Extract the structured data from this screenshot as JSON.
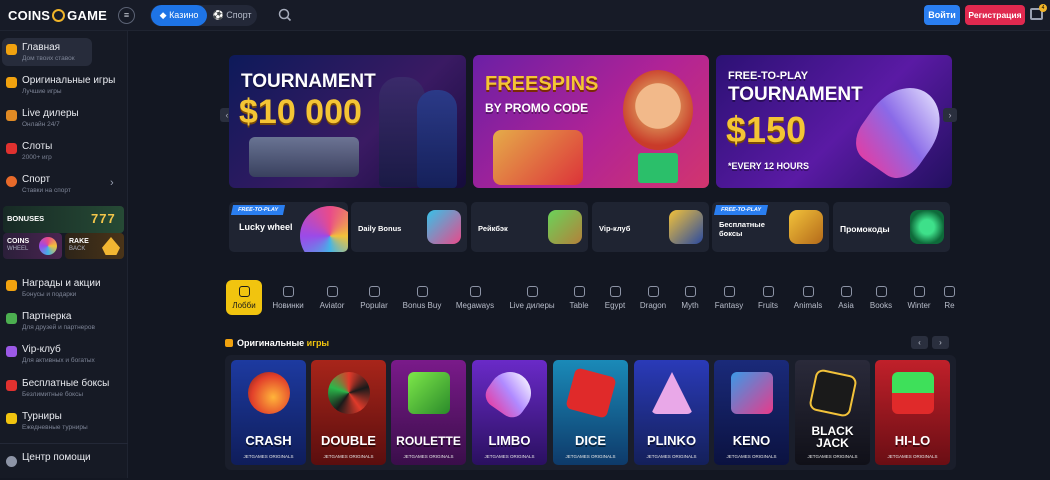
{
  "header": {
    "logo_left": "COINS",
    "logo_right": "GAME",
    "casino_label": "Казино",
    "sport_label": "Спорт",
    "login_label": "Войти",
    "register_label": "Регистрация",
    "chat_badge": "4"
  },
  "sidebar": {
    "items": [
      {
        "title": "Главная",
        "sub": "Дом твоих ставок",
        "icon": "home-icon"
      },
      {
        "title": "Оригинальные игры",
        "sub": "Лучшие игры",
        "icon": "cube-icon"
      },
      {
        "title": "Live дилеры",
        "sub": "Онлайн 24/7",
        "icon": "dealer-icon"
      },
      {
        "title": "Слоты",
        "sub": "2000+ игр",
        "icon": "slots-icon"
      },
      {
        "title": "Спорт",
        "sub": "Ставки на спорт",
        "icon": "ball-icon"
      }
    ],
    "bonuses_label": "BONUSES",
    "bonuses_value": "777",
    "coins_wheel_top": "COINS",
    "coins_wheel_bottom": "WHEEL",
    "rakeback_top": "RAKE",
    "rakeback_bottom": "BACK",
    "items2": [
      {
        "title": "Награды и акции",
        "sub": "Бонусы и подарки",
        "icon": "megaphone-icon"
      },
      {
        "title": "Партнерка",
        "sub": "Для друзей и партнеров",
        "icon": "partner-icon"
      },
      {
        "title": "Vip-клуб",
        "sub": "Для активных и богатых",
        "icon": "vip-icon"
      },
      {
        "title": "Бесплатные боксы",
        "sub": "Безлимитные боксы",
        "icon": "box-icon"
      },
      {
        "title": "Турниры",
        "sub": "Ежедневные турниры",
        "icon": "trophy-icon"
      }
    ],
    "help_label": "Центр помощи"
  },
  "banners": [
    {
      "line1": "TOURNAMENT",
      "line2": "$10 000"
    },
    {
      "line1": "FREESPINS",
      "line2": "BY PROMO CODE"
    },
    {
      "line1": "FREE-TO-PLAY",
      "line2": "TOURNAMENT",
      "line3": "$150",
      "line4": "*EVERY 12 HOURS"
    }
  ],
  "promos": [
    {
      "label": "Lucky wheel",
      "tag": "FREE-TO-PLAY"
    },
    {
      "label": "Daily Bonus"
    },
    {
      "label": "Рейкбэк"
    },
    {
      "label": "Vip-клуб"
    },
    {
      "label": "Бесплатные боксы",
      "tag": "FREE-TO-PLAY"
    },
    {
      "label": "Промокоды"
    }
  ],
  "categories": [
    "Лобби",
    "Новинки",
    "Aviator",
    "Popular",
    "Bonus Buy",
    "Megaways",
    "Live дилеры",
    "Table",
    "Egypt",
    "Dragon",
    "Myth",
    "Fantasy",
    "Fruits",
    "Animals",
    "Asia",
    "Books",
    "Winter",
    "Re"
  ],
  "section": {
    "title_white": "Оригинальные",
    "title_yellow": "игры"
  },
  "games": [
    {
      "name": "CRASH",
      "sub": "JETGAMES ORIGINALS"
    },
    {
      "name": "DOUBLE",
      "sub": "JETGAMES ORIGINALS"
    },
    {
      "name": "ROULETTE",
      "sub": "JETGAMES ORIGINALS"
    },
    {
      "name": "LIMBO",
      "sub": "JETGAMES ORIGINALS"
    },
    {
      "name": "DICE",
      "sub": "JETGAMES ORIGINALS"
    },
    {
      "name": "PLINKO",
      "sub": "JETGAMES ORIGINALS"
    },
    {
      "name": "KENO",
      "sub": "JETGAMES ORIGINALS"
    },
    {
      "name": "BLACK JACK",
      "sub": "JETGAMES ORIGINALS"
    },
    {
      "name": "HI-LO",
      "sub": "JETGAMES ORIGINALS"
    }
  ],
  "colors": {
    "accent": "#1e74e6",
    "register": "#e0294f",
    "yellow": "#f1c40f",
    "bg": "#131722"
  }
}
